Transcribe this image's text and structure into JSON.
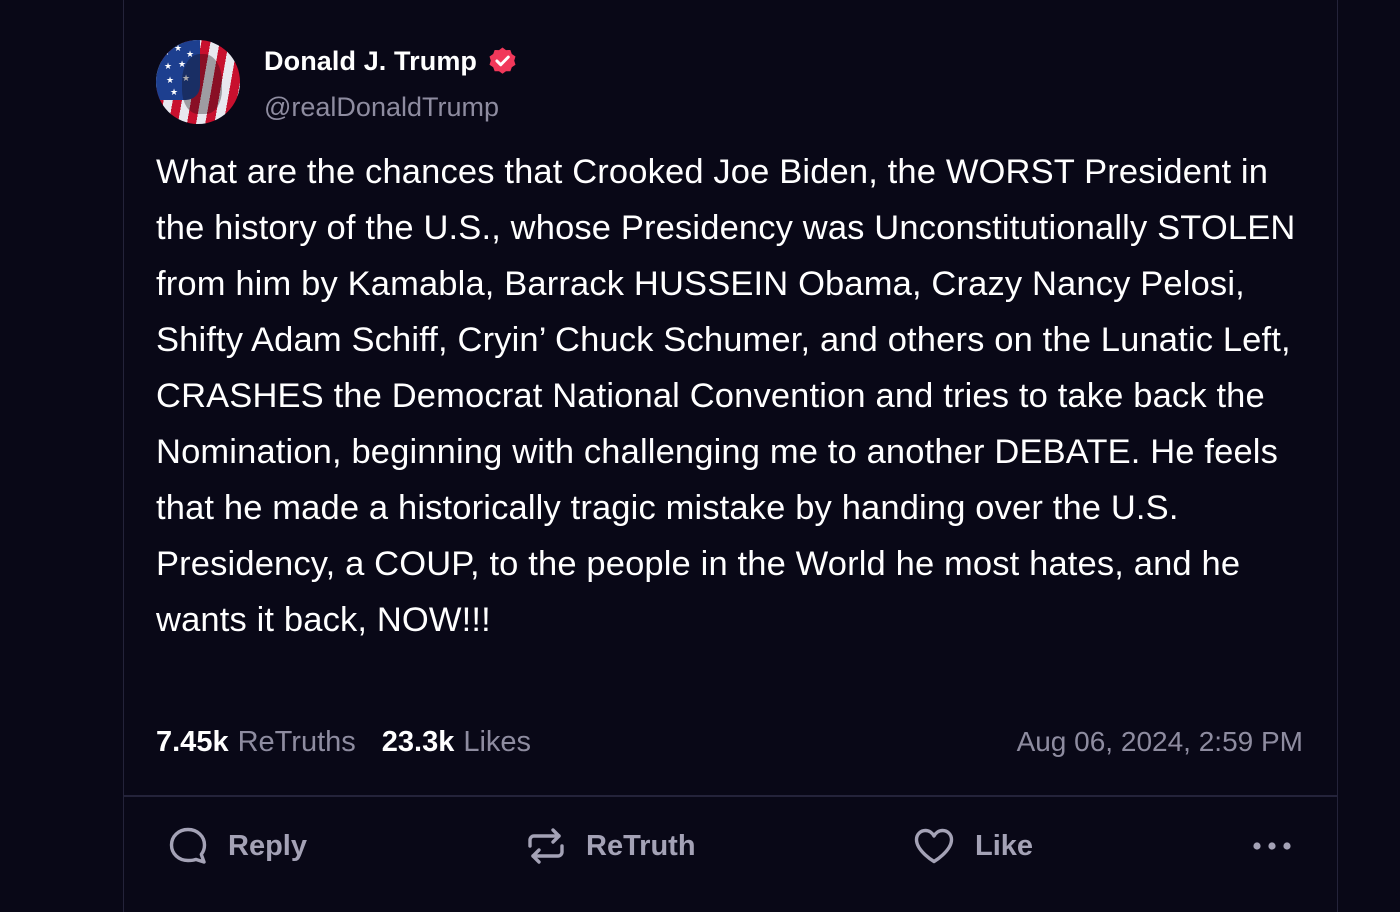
{
  "post": {
    "author_name": "Donald J. Trump",
    "handle": "@realDonaldTrump",
    "verified": true,
    "verified_color": "#f1385a",
    "body": "What are the chances that Crooked Joe Biden, the WORST President in the history of the U.S., whose Presidency was Unconstitutionally STOLEN from him by Kamabla, Barrack HUSSEIN Obama, Crazy Nancy Pelosi, Shifty Adam Schiff, Cryin’ Chuck Schumer, and others on the Lunatic Left, CRASHES the Democrat National Convention and tries to take back the Nomination, beginning with challenging me to another DEBATE. He feels that he made a historically tragic mistake by handing over the U.S. Presidency, a COUP, to the people in the World he most hates, and he wants it back, NOW!!!",
    "stats": {
      "retruths_count": "7.45k",
      "retruths_label": "ReTruths",
      "likes_count": "23.3k",
      "likes_label": "Likes"
    },
    "timestamp": "Aug 06, 2024, 2:59 PM"
  },
  "actions": {
    "reply_label": "Reply",
    "retruth_label": "ReTruth",
    "like_label": "Like"
  },
  "icons": {
    "reply": "speech-bubble-icon",
    "retruth": "repeat-arrows-icon",
    "like": "heart-icon",
    "more": "ellipsis-icon",
    "verified": "verified-badge-icon"
  },
  "colors": {
    "background": "#090817",
    "muted_text": "#8e8ca0",
    "action_text": "#a4a2b6",
    "divider": "#24233a"
  }
}
